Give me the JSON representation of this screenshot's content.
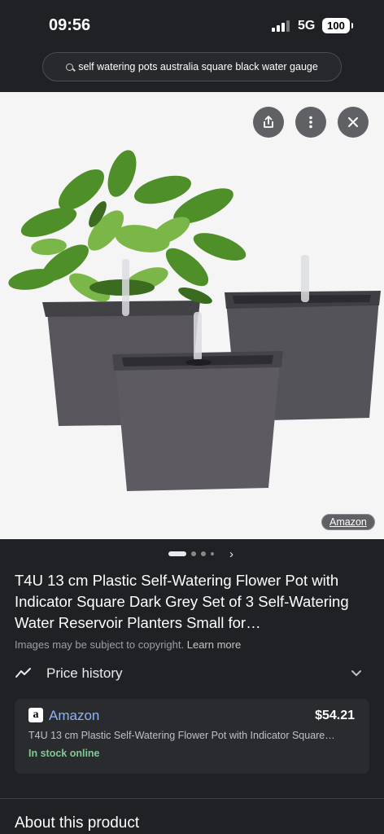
{
  "status_bar": {
    "time": "09:56",
    "network": "5G",
    "battery": "100"
  },
  "search": {
    "query": "self watering pots australia square black water gauge"
  },
  "image": {
    "source": "Amazon"
  },
  "carousel": {
    "next_icon": "chevron-right"
  },
  "product": {
    "title": "T4U 13 cm Plastic Self-Watering Flower Pot with Indicator Square Dark Grey Set of 3 Self-Watering Water Reservoir Planters Small for…",
    "copyright_note": "Images may be subject to copyright.",
    "learn_more": "Learn more"
  },
  "price_history": {
    "label": "Price history"
  },
  "offer": {
    "store": "Amazon",
    "price": "$54.21",
    "description": "T4U 13 cm Plastic Self-Watering Flower Pot with Indicator Square…",
    "stock": "In stock online",
    "stock_color": "#81c995",
    "link_color": "#8ab4f8"
  },
  "about": {
    "heading": "About this product"
  }
}
